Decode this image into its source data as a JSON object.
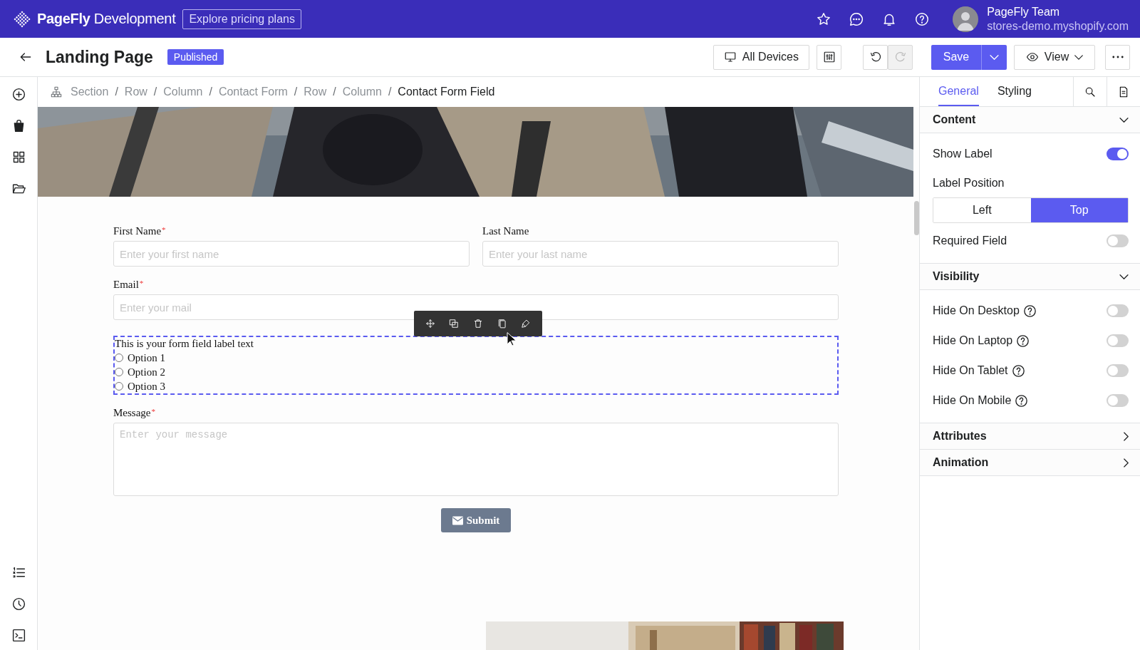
{
  "topbar": {
    "brand": "**PageFly** Development",
    "pricing_button": "Explore pricing plans",
    "user": {
      "name": "PageFly Team",
      "store": "stores-demo.myshopify.com"
    }
  },
  "header": {
    "title": "Landing Page",
    "status": "Published",
    "device_button": "All Devices",
    "undo": {
      "disabled": false
    },
    "redo": {
      "disabled": true
    },
    "save_button": "Save",
    "view_button": "View"
  },
  "breadcrumb": [
    {
      "label": "Section",
      "selected": false
    },
    {
      "separator": "/",
      "label": "Row",
      "selected": false
    },
    {
      "separator": "/",
      "label": "Column",
      "selected": false
    },
    {
      "separator": "/",
      "label": "Contact Form",
      "selected": false
    },
    {
      "separator": "/",
      "label": "Row",
      "selected": false
    },
    {
      "separator": "/",
      "label": "Column",
      "selected": false
    },
    {
      "separator": "/",
      "label": "Contact Form Field",
      "selected": true
    }
  ],
  "form": {
    "rows": [
      {
        "fields": [
          {
            "kind": "text",
            "label": "First Name",
            "required_mark": "*",
            "placeholder": "Enter your first name"
          },
          {
            "kind": "text",
            "label": "Last Name",
            "placeholder": "Enter your last name"
          }
        ]
      },
      {
        "fields": [
          {
            "kind": "text",
            "label": "Email",
            "required_mark": "*",
            "placeholder": "Enter your mail"
          }
        ]
      },
      {
        "fields": [
          {
            "kind": "radio",
            "label": "This is your form field label text",
            "selected": true,
            "options": [
              {
                "label": "Option 1",
                "selected": false
              },
              {
                "label": "Option 2",
                "selected": false
              },
              {
                "label": "Option 3",
                "selected": false
              }
            ]
          }
        ]
      },
      {
        "fields": [
          {
            "kind": "textarea",
            "label": "Message",
            "required_mark": "*",
            "placeholder": "Enter your message"
          }
        ]
      }
    ],
    "submit": "Submit"
  },
  "panel": {
    "tabs": [
      {
        "label": "General",
        "selected": true
      },
      {
        "label": "Styling",
        "selected": false
      }
    ],
    "sections": [
      {
        "title": "Content",
        "expanded": true,
        "settings": [
          {
            "kind": "toggle",
            "label": "Show Label",
            "on": true
          },
          {
            "kind": "segmented",
            "label": "Label Position",
            "options": [
              {
                "label": "Left",
                "selected": false
              },
              {
                "label": "Top",
                "selected": true
              }
            ]
          },
          {
            "kind": "toggle",
            "label": "Required Field",
            "on": false
          }
        ]
      },
      {
        "title": "Visibility",
        "expanded": true,
        "settings": [
          {
            "kind": "toggle",
            "label": "Hide On Desktop",
            "help": true,
            "on": false
          },
          {
            "kind": "toggle",
            "label": "Hide On Laptop",
            "help": true,
            "on": false
          },
          {
            "kind": "toggle",
            "label": "Hide On Tablet",
            "help": true,
            "on": false
          },
          {
            "kind": "toggle",
            "label": "Hide On Mobile",
            "help": true,
            "on": false
          }
        ]
      },
      {
        "title": "Attributes",
        "expanded": false
      },
      {
        "title": "Animation",
        "expanded": false
      }
    ]
  }
}
